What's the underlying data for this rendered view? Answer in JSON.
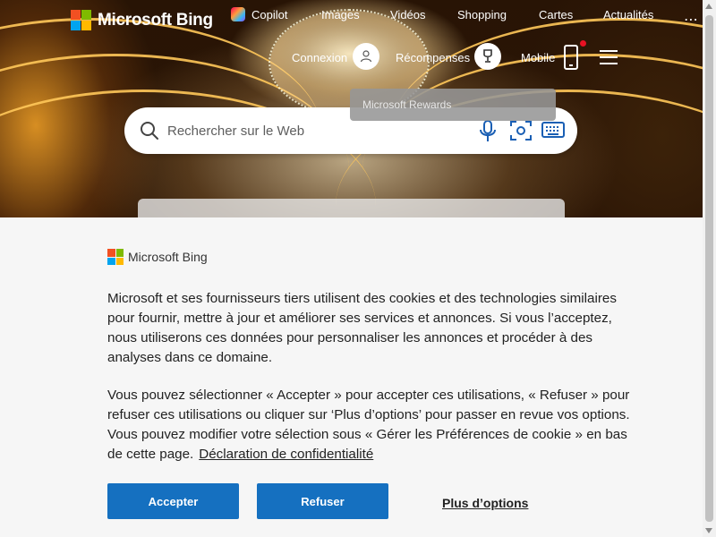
{
  "header": {
    "logo_text": "Microsoft Bing",
    "nav": [
      {
        "label": "Copilot",
        "icon": "copilot-icon"
      },
      {
        "label": "Images"
      },
      {
        "label": "Vidéos"
      },
      {
        "label": "Shopping"
      },
      {
        "label": "Cartes"
      },
      {
        "label": "Actualités"
      }
    ],
    "more": "⋯",
    "signin_label": "Connexion",
    "rewards_label": "Récompenses",
    "mobile_label": "Mobile",
    "rewards_tooltip": "Microsoft Rewards"
  },
  "search": {
    "placeholder": "Rechercher sur le Web"
  },
  "cookie": {
    "logo_text": "Microsoft Bing",
    "paragraph1": "Microsoft et ses fournisseurs tiers utilisent des cookies et des technologies similaires pour fournir, mettre à jour et améliorer ses services et annonces. Si vous l’acceptez, nous utiliserons ces données pour personnaliser les annonces et procéder à des analyses dans ce domaine.",
    "paragraph2": "Vous pouvez sélectionner « Accepter » pour accepter ces utilisations, « Refuser » pour refuser ces utilisations ou cliquer sur ‘Plus d’options’ pour passer en revue vos options. Vous pouvez modifier votre sélection sous « Gérer les Préférences de cookie » en bas de cette page.",
    "privacy_link": "Déclaration de confidentialité",
    "accept_label": "Accepter",
    "refuse_label": "Refuser",
    "more_options_label": "Plus d’options"
  },
  "colors": {
    "accent": "#1570c0",
    "ms_red": "#f25022",
    "ms_green": "#7fba00",
    "ms_blue": "#00a4ef",
    "ms_yellow": "#ffb900"
  }
}
